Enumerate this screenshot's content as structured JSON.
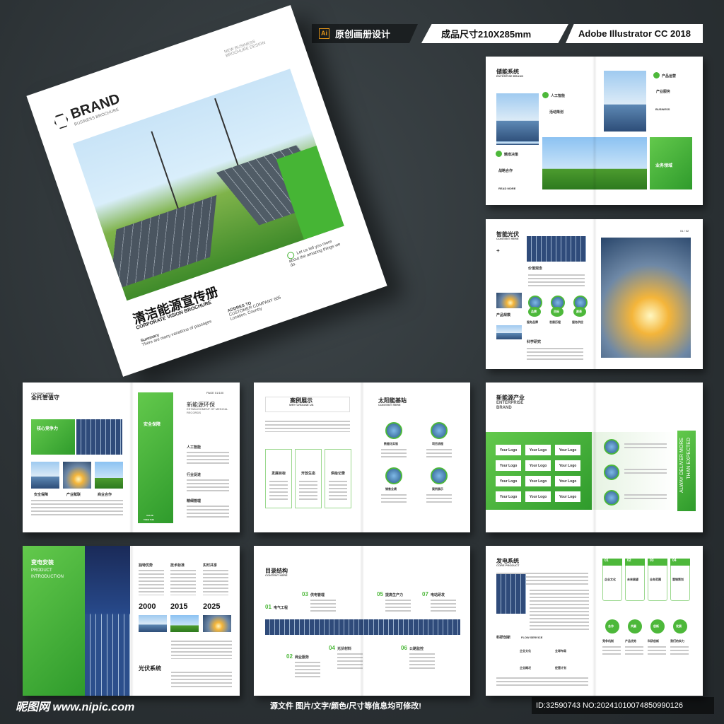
{
  "header": {
    "ai_icon": "Ai",
    "tag1": "原创画册设计",
    "tag2": "成品尺寸210X285mm",
    "tag3": "Adobe Illustrator CC 2018"
  },
  "cover": {
    "brand": "BRAND",
    "brand_sub": "BUSINESS BROCHURE",
    "corner": "NEW BUSINESS BROCHURE DESIGN",
    "title": "清洁能源宣传册",
    "subtitle": "CORPORATE VISION BROCHURE",
    "summary_title": "Summary",
    "summary": "There are many variations of passages",
    "addr_title": "ADDRES TO",
    "addr": "CUSTOMER COMPANY 605 Location, Country",
    "tell": "Let us tell you more about the amazing things we do."
  },
  "s1": {
    "title": "储能系统",
    "sub": "ENTERPISE BRAND",
    "l1": "人工智能",
    "l2": "活动策划",
    "l3": "精准决策",
    "l4": "战略合作",
    "r1": "产品运营",
    "r2": "产业服务",
    "r3": "业务领域",
    "more": "READ MORE",
    "biz": "BUSINESS"
  },
  "s2": {
    "title": "智能光伏",
    "sub": "CONTENT HERE",
    "plus": "+",
    "l1": "价值观念",
    "l2": "产品规模",
    "l3": "科学研究",
    "c1": "服务品牌",
    "c2": "发展历程",
    "c3": "服务供应",
    "g1": "品牌",
    "g2": "目标",
    "g3": "愿景",
    "page": "01 / 02"
  },
  "s3": {
    "title": "全托管值守",
    "sub": "CONTENT HERE",
    "core": "核心竞争力",
    "i1": "安全保障",
    "i2": "产业赋联",
    "i3": "商业合作",
    "safe": "安全保障",
    "r_title": "新能源环保",
    "r_sub": "ESTABLISHMENT OF MEDICAL RECORDS",
    "r1": "人工智能",
    "r2": "行业促进",
    "r3": "精细管理",
    "page": "PAGE 01/100",
    "v1": "VALUE",
    "v2": "TAKE THE"
  },
  "s4": {
    "left_title": "案例展示",
    "left_sub": "WHY CHOOSE US",
    "b1": "发展目标",
    "b2": "开放生态",
    "b3": "供给记录",
    "right_title": "太阳能基站",
    "right_sub": "CONTENT HERE",
    "c1": "数据化实验",
    "c2": "项目流程",
    "c3": "销售业绩",
    "c4": "案例展示"
  },
  "s5": {
    "title": "新能源产业",
    "sub1": "ENTERPRISE",
    "sub2": "BRAND",
    "logo": "Your Logo",
    "vert1": "ALWAY DELIVER MORE",
    "vert2": "THAN EXPECTED"
  },
  "s6": {
    "title": "变电安装",
    "sub1": "PRODUCT",
    "sub2": "INTRODUCTION",
    "t1": "独特优势",
    "t2": "技术标准",
    "t3": "实时共享",
    "y1": "2000",
    "y2": "2015",
    "y3": "2025",
    "bottom": "光伏系统"
  },
  "s7": {
    "title": "目录结构",
    "sub": "CONTENT HERE",
    "n1": "01",
    "t1": "电气工程",
    "n2": "02",
    "t2": "商业服务",
    "n3": "03",
    "t3": "供电管理",
    "n4": "04",
    "t4": "光伏材料",
    "n5": "05",
    "t5": "提高生产力",
    "n6": "06",
    "t6": "公路监控",
    "n7": "07",
    "t7": "电站研发"
  },
  "s8": {
    "title": "发电系统",
    "sub": "CORE PRODUCT",
    "step_nums": [
      "01",
      "02",
      "03",
      "04"
    ],
    "steps": [
      "企业文化",
      "未来展望",
      "业务范围",
      "营销策划"
    ],
    "g": [
      "合作",
      "共赢",
      "创新",
      "发展"
    ],
    "gl": [
      "竞争机制",
      "产品优势",
      "科研创新",
      "我们的实力"
    ],
    "r1": "科研创新",
    "r2": "FLOW SERVICE",
    "sm1": "企业文化",
    "sm2": "全球布局",
    "sm3": "企业概况",
    "sm4": "经营计划"
  },
  "footer": {
    "site": "昵图网 www.nipic.com",
    "note": "源文件 图片/文字/颜色/尺寸等信息均可修改!",
    "id": "ID:32590743 NO:20241010074850990126"
  }
}
